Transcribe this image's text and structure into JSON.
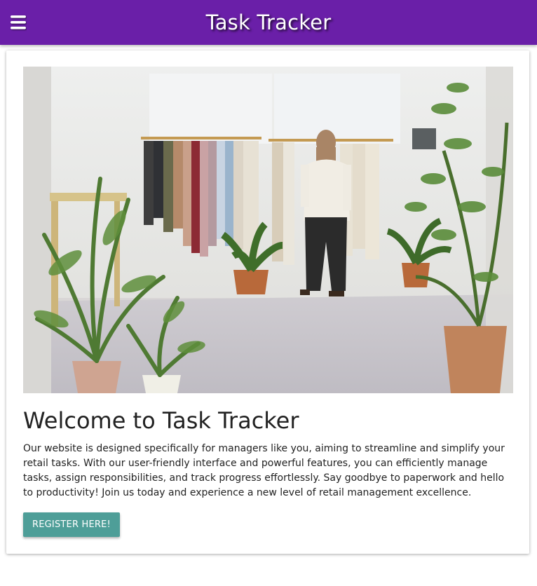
{
  "app": {
    "title": "Task Tracker",
    "menu_icon": "hamburger-menu-icon"
  },
  "colors": {
    "topbar": "#6a1fa8",
    "button": "#4e9e98",
    "text": "#222222"
  },
  "hero_image": {
    "subject": "photo"
  },
  "welcome": {
    "heading": "Welcome to Task Tracker",
    "body": "Our website is designed specifically for managers like you, aiming to streamline and simplify your retail tasks. With our user-friendly interface and powerful features, you can efficiently manage tasks, assign responsibilities, and track progress effortlessly. Say goodbye to paperwork and hello to productivity! Join us today and experience a new level of retail management excellence.",
    "register_label": "REGISTER HERE!"
  }
}
